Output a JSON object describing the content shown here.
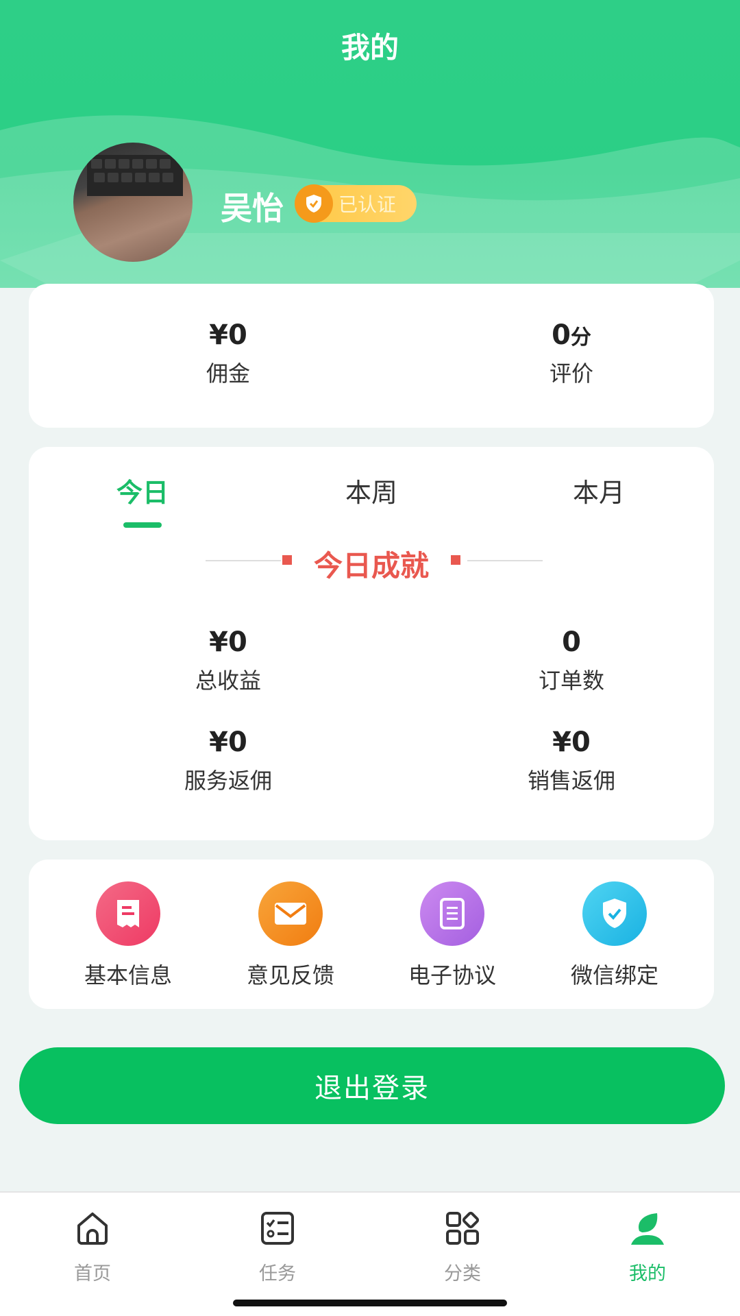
{
  "header": {
    "title": "我的"
  },
  "user": {
    "name": "吴怡",
    "verified_label": "已认证"
  },
  "summary": {
    "commission": {
      "value": "¥0",
      "label": "佣金"
    },
    "rating": {
      "value": "0",
      "unit": "分",
      "label": "评价"
    }
  },
  "achievements": {
    "tabs": [
      "今日",
      "本周",
      "本月"
    ],
    "active_tab": "今日",
    "title": "今日成就",
    "stats": [
      {
        "value": "¥0",
        "label": "总收益"
      },
      {
        "value": "0",
        "label": "订单数"
      },
      {
        "value": "¥0",
        "label": "服务返佣"
      },
      {
        "value": "¥0",
        "label": "销售返佣"
      }
    ]
  },
  "menu": [
    {
      "label": "基本信息",
      "icon": "receipt-icon",
      "color": "#f0456f"
    },
    {
      "label": "意见反馈",
      "icon": "mail-icon",
      "color": "#f6921e"
    },
    {
      "label": "电子协议",
      "icon": "document-icon",
      "color": "#b46ae6"
    },
    {
      "label": "微信绑定",
      "icon": "shield-check-icon",
      "color": "#27c2ea"
    }
  ],
  "logout_label": "退出登录",
  "tabbar": {
    "items": [
      {
        "label": "首页",
        "icon": "home-icon"
      },
      {
        "label": "任务",
        "icon": "tasks-icon"
      },
      {
        "label": "分类",
        "icon": "category-icon"
      },
      {
        "label": "我的",
        "icon": "profile-leaf-icon"
      }
    ],
    "active": "我的"
  },
  "colors": {
    "brand": "#1bbd68",
    "header": "#2ecf87",
    "accent_red": "#e9584f",
    "logout": "#08c060"
  }
}
